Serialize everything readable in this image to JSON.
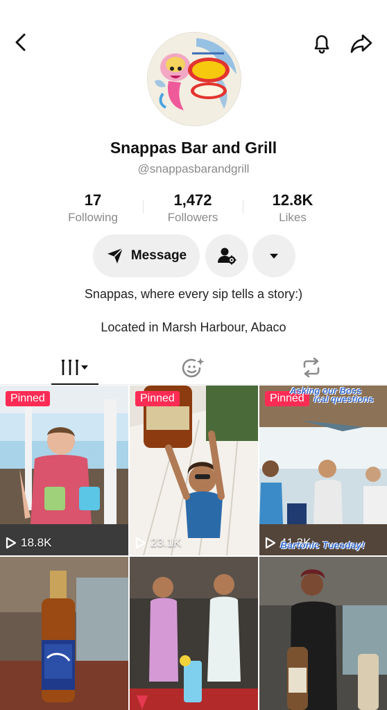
{
  "profile": {
    "name": "Snappas Bar and Grill",
    "handle": "@snappasbarandgrill",
    "bio": "Snappas, where every sip tells a story:)",
    "location": "Located in Marsh Harbour, Abaco"
  },
  "stats": [
    {
      "value": "17",
      "label": "Following"
    },
    {
      "value": "1,472",
      "label": "Followers"
    },
    {
      "value": "12.8K",
      "label": "Likes"
    }
  ],
  "actions": {
    "message_label": "Message"
  },
  "videos": [
    {
      "pinned_label": "Pinned",
      "views": "18.8K"
    },
    {
      "pinned_label": "Pinned",
      "views": "23.1K"
    },
    {
      "pinned_label": "Pinned",
      "views": "41.3K",
      "overlay_top": "Asking our Boss",
      "overlay_top2": "ical questions",
      "overlay_bottom": "Bartonic Tuesday!"
    },
    {},
    {},
    {}
  ],
  "icons": {
    "back": "back-arrow-icon",
    "bell": "bell-icon",
    "share": "share-icon",
    "message": "send-icon",
    "follow_settings": "person-settings-icon",
    "more": "caret-down-icon",
    "videos_tab": "grid-icon",
    "liked_tab": "face-sparkle-icon",
    "reposts_tab": "repost-icon",
    "play": "play-icon"
  },
  "colors": {
    "pinned": "#fe2c55",
    "button_bg": "#efefef",
    "muted_text": "#8a8a8a"
  }
}
